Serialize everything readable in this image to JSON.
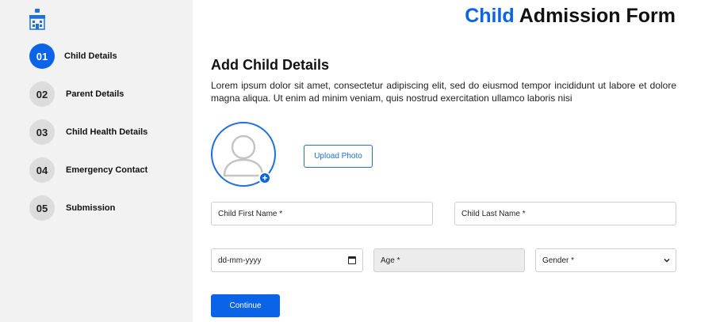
{
  "sidebar": {
    "logo_icon": "school-building-icon",
    "steps": [
      {
        "number": "01",
        "label": "Child Details",
        "active": true
      },
      {
        "number": "02",
        "label": "Parent Details",
        "active": false
      },
      {
        "number": "03",
        "label": "Child Health Details",
        "active": false
      },
      {
        "number": "04",
        "label": "Emergency Contact",
        "active": false
      },
      {
        "number": "05",
        "label": "Submission",
        "active": false
      }
    ]
  },
  "header": {
    "title_accent": "Child",
    "title_rest": "Admission Form"
  },
  "main": {
    "section_title": "Add Child Details",
    "section_description": "Lorem ipsum dolor sit amet, consectetur adipiscing elit, sed do eiusmod tempor incididunt ut labore et dolore magna aliqua. Ut enim ad minim veniam, quis nostrud exercitation ullamco laboris nisi",
    "photo": {
      "avatar_icon": "user-placeholder-icon",
      "add_icon": "plus-circle-icon",
      "add_symbol": "+",
      "upload_label": "Upload Photo"
    },
    "fields": {
      "first_name_placeholder": "Child First Name *",
      "last_name_placeholder": "Child Last Name *",
      "dob_placeholder": "dd-mm-yyyy",
      "age_placeholder": "Age *",
      "gender_selected": "Gender *"
    },
    "continue_label": "Continue"
  },
  "colors": {
    "accent": "#0b63e8",
    "sidebar_bg": "#f2f2f2",
    "step_inactive_bg": "#dcdcdc",
    "disabled_field_bg": "#ececec"
  }
}
